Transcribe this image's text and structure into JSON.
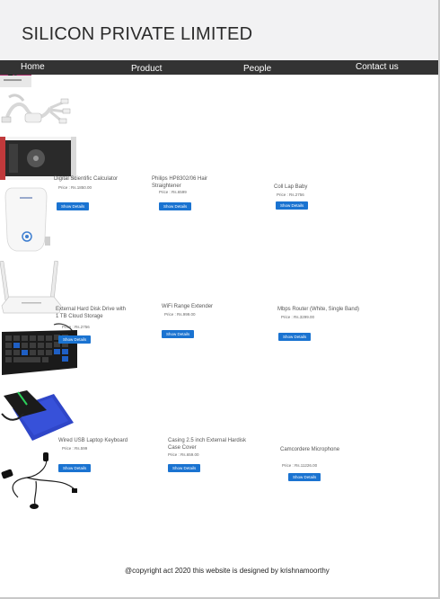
{
  "site": {
    "title": "SILICON PRIVATE LIMITED"
  },
  "nav": {
    "home": "Home",
    "product": "Product",
    "people": "People",
    "contact": "Contact us"
  },
  "products": [
    {
      "name": "Digital Scientific Calculator",
      "price": "Price : Rs.1850.00",
      "button": "Show Details"
    },
    {
      "name": "Philips HP8302/06 Hair Straightener",
      "price": "Price : Rs.6599",
      "button": "Show Details"
    },
    {
      "name": "Coll Lap Baby",
      "price": "Price : Rs.2756",
      "button": "Show Details"
    },
    {
      "name": "External Hard Disk Drive with 1 TB Cloud Storage",
      "price": "Price : Rs.2756",
      "button": "Show Details"
    },
    {
      "name": "WiFi Range Extender",
      "price": "Price : Rs.999.00",
      "button": "Show Details"
    },
    {
      "name": "Mbps Router (White, Single Band)",
      "price": "Price : Rs.3299.00",
      "button": "Show Details"
    },
    {
      "name": "Wired USB Laptop Keyboard",
      "price": "Price : Rs.599",
      "button": "Show Details"
    },
    {
      "name": "Casing 2.5 inch External Hardisk Case Cover",
      "price": "Price : Rs.659.00",
      "button": "Show Details"
    },
    {
      "name": "Camcordere Microphone",
      "price": "Price : Rs.11226.00",
      "button": "Show Details"
    }
  ],
  "footer": {
    "text": "@copyright act 2020 this website is designed by krishnamoorthy"
  }
}
